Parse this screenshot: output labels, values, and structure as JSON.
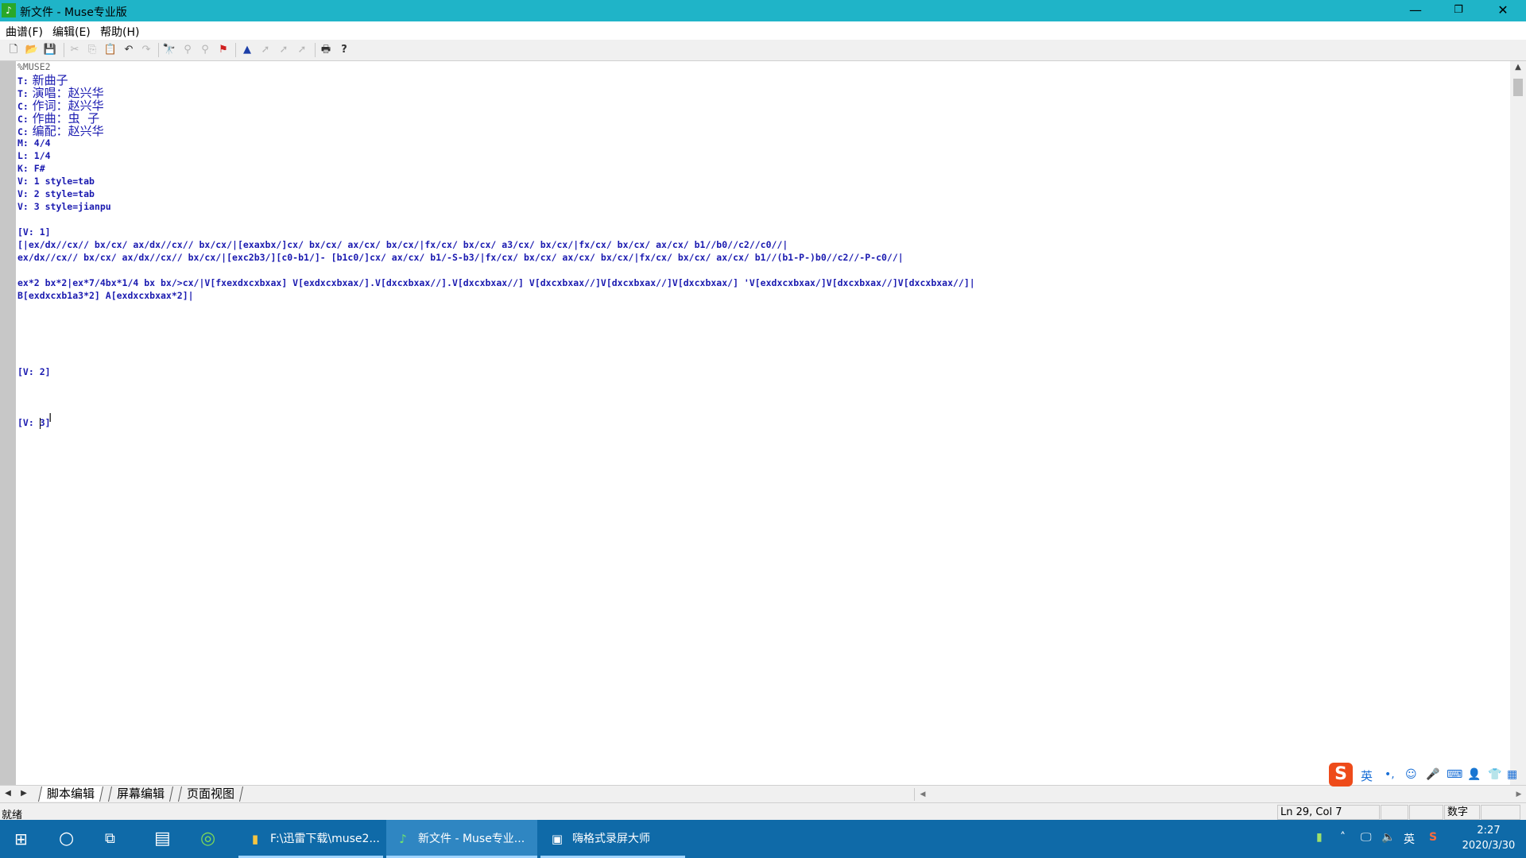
{
  "window": {
    "app_icon": "muse-app-icon",
    "title": "新文件 - Muse专业版",
    "minimize": "—",
    "restore": "❐",
    "close": "✕"
  },
  "menu": [
    "曲谱(F)",
    "编辑(E)",
    "帮助(H)"
  ],
  "editor": {
    "header": "%MUSE2",
    "meta_lines": [
      {
        "key": "T:",
        "value": "新曲子"
      },
      {
        "key": "T:",
        "value": "演唱：赵兴华"
      },
      {
        "key": "C:",
        "value": "作词：赵兴华"
      },
      {
        "key": "C:",
        "value": "作曲：虫  子"
      },
      {
        "key": "C:",
        "value": "编配：赵兴华"
      }
    ],
    "code_lines": [
      "M: 4/4",
      "L: 1/4",
      "K: F#",
      "V: 1 style=tab",
      "V: 2 style=tab",
      "V: 3 style=jianpu"
    ],
    "v1_label": "[V: 1]",
    "v1_lines": [
      "[|ex/dx//cx// bx/cx/ ax/dx//cx// bx/cx/|[exaxbx/]cx/ bx/cx/ ax/cx/ bx/cx/|fx/cx/ bx/cx/ a3/cx/ bx/cx/|fx/cx/ bx/cx/ ax/cx/ b1//b0//c2//c0//|",
      "ex/dx//cx// bx/cx/ ax/dx//cx// bx/cx/|[exc2b3/][c0-b1/]- [b1c0/]cx/ ax/cx/ b1/-S-b3/|fx/cx/ bx/cx/ ax/cx/ bx/cx/|fx/cx/ bx/cx/ ax/cx/ b1//(b1-P-)b0//c2//-P-c0//|",
      "ex*2 bx*2|ex*7/4bx*1/4 bx bx/>cx/|V[fxexdxcxbxax] V[exdxcxbxax/].V[dxcxbxax//].V[dxcxbxax//] V[dxcxbxax//]V[dxcxbxax//]V[dxcxbxax/] 'V[exdxcxbxax/]V[dxcxbxax//]V[dxcxbxax//]|",
      "B[exdxcxb1a3*2] A[exdxcxbxax*2]|"
    ],
    "v2_label": "[V: 2]",
    "v3_label": "[V: 3]"
  },
  "tabs": [
    "脚本编辑",
    "屏幕编辑",
    "页面视图"
  ],
  "ime": {
    "logo": "S",
    "mode": "英"
  },
  "status": {
    "text": "就绪",
    "position": "Ln 29, Col 7",
    "numlock": "数字"
  },
  "taskbar": {
    "tasks": [
      {
        "icon": "folder-icon",
        "label": "F:\\迅雷下载\\muse2..."
      },
      {
        "icon": "muse-app-icon",
        "label": "新文件 - Muse专业..."
      },
      {
        "icon": "screen-recorder-icon",
        "label": "嗨格式录屏大师"
      }
    ],
    "tray_lang": "英",
    "time": "2:27",
    "date": "2020/3/30"
  }
}
